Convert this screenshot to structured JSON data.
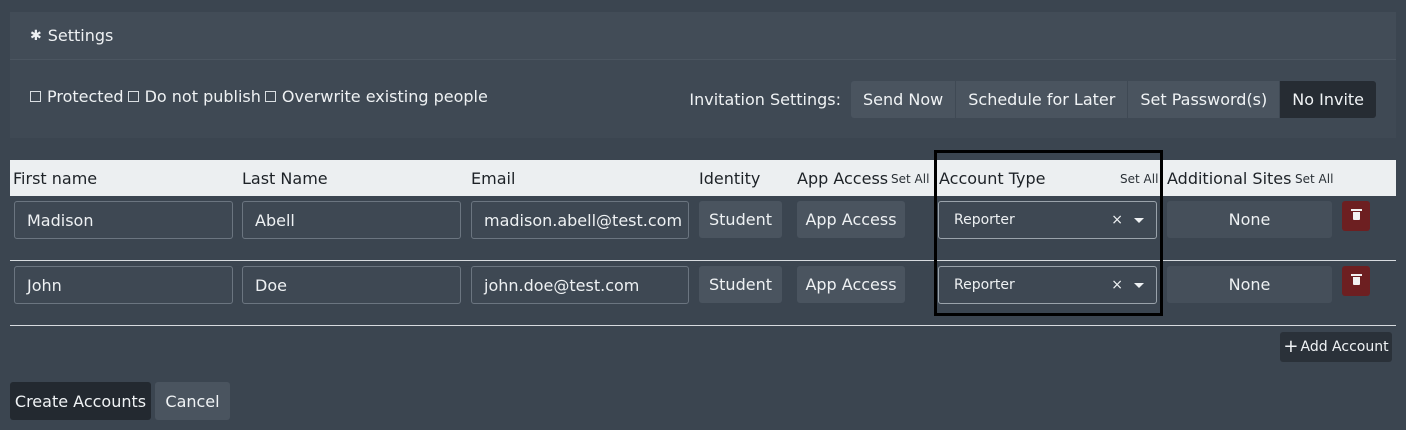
{
  "settings": {
    "title": "Settings",
    "icon": "gear-icon",
    "checkboxes": [
      {
        "label": "Protected",
        "checked": false
      },
      {
        "label": "Do not publish",
        "checked": false
      },
      {
        "label": "Overwrite existing people",
        "checked": false
      }
    ],
    "invitation": {
      "label": "Invitation Settings:",
      "options": [
        "Send Now",
        "Schedule for Later",
        "Set Password(s)",
        "No Invite"
      ],
      "selected": "No Invite"
    }
  },
  "table": {
    "headers": {
      "first_name": "First name",
      "last_name": "Last Name",
      "email": "Email",
      "identity": "Identity",
      "app_access": "App Access",
      "account_type": "Account Type",
      "additional_sites": "Additional Sites",
      "set_all": "Set All"
    },
    "rows": [
      {
        "first_name": "Madison",
        "last_name": "Abell",
        "email": "madison.abell@test.com",
        "identity": "Student",
        "app_access": "App Access",
        "account_type": "Reporter",
        "additional_sites": "None"
      },
      {
        "first_name": "John",
        "last_name": "Doe",
        "email": "john.doe@test.com",
        "identity": "Student",
        "app_access": "App Access",
        "account_type": "Reporter",
        "additional_sites": "None"
      }
    ],
    "clear_glyph": "×"
  },
  "actions": {
    "add_account": "Add Account",
    "create_accounts": "Create Accounts",
    "cancel": "Cancel"
  },
  "colors": {
    "background": "#3b4550",
    "panel": "#424c57",
    "header_bar": "#eceff1",
    "delete": "#6d1f21",
    "primary_button": "#232930",
    "highlight_border": "#000000"
  }
}
